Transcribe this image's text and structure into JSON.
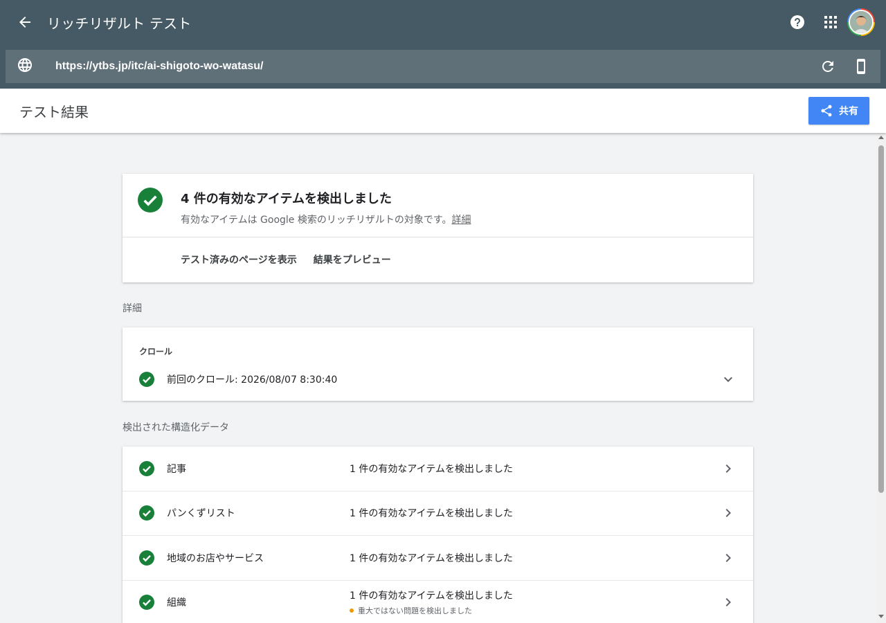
{
  "app": {
    "title": "リッチリザルト テスト"
  },
  "url_bar": {
    "url": "https://ytbs.jp/itc/ai-shigoto-wo-watasu/"
  },
  "subheader": {
    "title": "テスト結果",
    "share_label": "共有"
  },
  "summary": {
    "title": "4 件の有効なアイテムを検出しました",
    "subtitle": "有効なアイテムは Google 検索のリッチリザルトの対象です。",
    "detail_link": "詳細",
    "actions": [
      "テスト済みのページを表示",
      "結果をプレビュー"
    ]
  },
  "details": {
    "section_label": "詳細",
    "crawl_label": "クロール",
    "crawl_text": "前回のクロール: 2026/08/07 8:30:40"
  },
  "structured_data": {
    "section_label": "検出された構造化データ",
    "items": [
      {
        "name": "記事",
        "status": "1 件の有効なアイテムを検出しました",
        "warning": ""
      },
      {
        "name": "パンくずリスト",
        "status": "1 件の有効なアイテムを検出しました",
        "warning": ""
      },
      {
        "name": "地域のお店やサービス",
        "status": "1 件の有効なアイテムを検出しました",
        "warning": ""
      },
      {
        "name": "組織",
        "status": "1 件の有効なアイテムを検出しました",
        "warning": "重大ではない問題を検出しました"
      }
    ]
  },
  "colors": {
    "appbar": "#455a64",
    "urlbar": "#5f7079",
    "accent": "#4285f4",
    "success": "#188038",
    "warning": "#f29900"
  },
  "icons": [
    "back-arrow-icon",
    "help-icon",
    "apps-grid-icon",
    "globe-icon",
    "refresh-icon",
    "mobile-device-icon",
    "share-icon",
    "check-circle-icon",
    "chevron-down-icon",
    "chevron-right-icon"
  ]
}
